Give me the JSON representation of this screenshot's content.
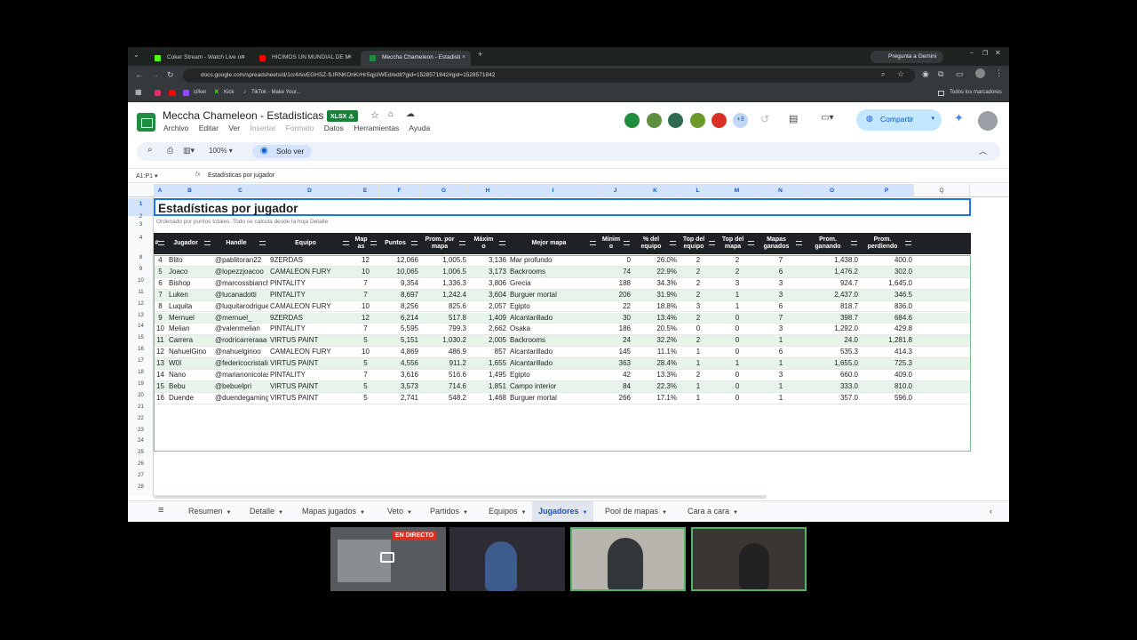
{
  "browser": {
    "tabs": [
      {
        "label": "Coker Stream - Watch Live on"
      },
      {
        "label": "HICIMOS UN MUNDIAL DE M"
      },
      {
        "label": "Meccha Chameleon - Estadisti"
      }
    ],
    "new_tab": "+",
    "gemini": "Pregunta a Gemini",
    "url": "docs.google.com/spreadsheets/d/1cr4AivEGHSZ-fLIRNKOnKrHrSqjclWEd/edit?gid=1528571842#gid=1528571842",
    "bookmarks": [
      "cl/ker",
      "Kick",
      "TikTok - Make Your..."
    ],
    "all_bookmarks": "Todos los marcadores"
  },
  "sheet": {
    "title": "Meccha Chameleon - Estadisticas",
    "badge": "XLSX",
    "menus": [
      "Archivo",
      "Editar",
      "Ver",
      "Insertar",
      "Formato",
      "Datos",
      "Herramientas",
      "Ayuda"
    ],
    "collaborators_more": "+3",
    "share": "Compartir",
    "zoom": "100%",
    "view_mode": "Solo ver",
    "name_box": "A1:P1",
    "fx": "fx",
    "formula": "Estadísticas por jugador"
  },
  "columns": [
    "A",
    "B",
    "C",
    "D",
    "E",
    "F",
    "G",
    "H",
    "I",
    "J",
    "K",
    "L",
    "M",
    "N",
    "O",
    "P",
    "Q"
  ],
  "row_numbers": [
    "1",
    "2",
    "3",
    "4",
    "8",
    "9",
    "10",
    "11",
    "12",
    "13",
    "14",
    "15",
    "16",
    "17",
    "18",
    "19",
    "20",
    "21",
    "22",
    "23",
    "24",
    "25",
    "26",
    "27",
    "28"
  ],
  "content": {
    "heading": "Estadísticas por jugador",
    "subheading": "Ordenado por puntos totales. Todo se calcula desde la hoja Detalle",
    "headers": [
      "#",
      "Jugador",
      "Handle",
      "Equipo",
      "Map\nas",
      "Puntos",
      "Prom. por\nmapa",
      "Máxim\no",
      "Mejor mapa",
      "Mínim\no",
      "% del\nequipo",
      "Top del\nequipo",
      "Top del\nmapa",
      "Mapas\nganados",
      "Prom.\nganando",
      "Prom.\nperdiendo"
    ],
    "rows": [
      [
        "4",
        "Blito",
        "@pablitoran22",
        "9ZERDAS",
        "12",
        "12,066",
        "1,005.5",
        "3,136",
        "Mar profundo",
        "0",
        "26.0%",
        "2",
        "2",
        "7",
        "1,438.0",
        "400.0"
      ],
      [
        "5",
        "Joaco",
        "@lopezzjoacoo",
        "CAMALEON FURY",
        "10",
        "10,065",
        "1,006.5",
        "3,173",
        "Backrooms",
        "74",
        "22.9%",
        "2",
        "2",
        "6",
        "1,476.2",
        "302.0"
      ],
      [
        "6",
        "Bishop",
        "@marcossbianchi",
        "PINTALITY",
        "7",
        "9,354",
        "1,336.3",
        "3,806",
        "Grecia",
        "188",
        "34.3%",
        "2",
        "3",
        "3",
        "924.7",
        "1,645.0"
      ],
      [
        "7",
        "Luken",
        "@lucanadotti",
        "PINTALITY",
        "7",
        "8,697",
        "1,242.4",
        "3,604",
        "Burguer mortal",
        "206",
        "31.9%",
        "2",
        "1",
        "3",
        "2,437.0",
        "346.5"
      ],
      [
        "8",
        "Luquita",
        "@luquitarodrigue",
        "CAMALEON FURY",
        "10",
        "8,256",
        "825.6",
        "2,057",
        "Egipto",
        "22",
        "18.8%",
        "3",
        "1",
        "6",
        "818.7",
        "836.0"
      ],
      [
        "9",
        "Mernuel",
        "@mernuel_",
        "9ZERDAS",
        "12",
        "6,214",
        "517.8",
        "1,409",
        "Alcantarillado",
        "30",
        "13.4%",
        "2",
        "0",
        "7",
        "398.7",
        "684.6"
      ],
      [
        "10",
        "Melian",
        "@valenmelian",
        "PINTALITY",
        "7",
        "5,595",
        "799.3",
        "2,662",
        "Osaka",
        "186",
        "20.5%",
        "0",
        "0",
        "3",
        "1,292.0",
        "429.8"
      ],
      [
        "11",
        "Carrera",
        "@rodricarreraaa",
        "VIRTUS PAINT",
        "5",
        "5,151",
        "1,030.2",
        "2,005",
        "Backrooms",
        "24",
        "32.2%",
        "2",
        "0",
        "1",
        "24.0",
        "1,281.8"
      ],
      [
        "12",
        "NahuelGino",
        "@nahuelginoo",
        "CAMALEON FURY",
        "10",
        "4,869",
        "486.9",
        "857",
        "Alcantarillado",
        "145",
        "11.1%",
        "1",
        "0",
        "6",
        "535.3",
        "414.3"
      ],
      [
        "13",
        "W0I",
        "@federicocristalino",
        "VIRTUS PAINT",
        "5",
        "4,556",
        "911.2",
        "1,655",
        "Alcantarillado",
        "363",
        "28.4%",
        "1",
        "1",
        "1",
        "1,655.0",
        "725.3"
      ],
      [
        "14",
        "Nano",
        "@marianonicolas",
        "PINTALITY",
        "7",
        "3,616",
        "516.6",
        "1,495",
        "Egipto",
        "42",
        "13.3%",
        "2",
        "0",
        "3",
        "660.0",
        "409.0"
      ],
      [
        "15",
        "Bebu",
        "@bebuelpri",
        "VIRTUS PAINT",
        "5",
        "3,573",
        "714.6",
        "1,851",
        "Campo interior",
        "84",
        "22.3%",
        "1",
        "0",
        "1",
        "333.0",
        "810.0"
      ],
      [
        "16",
        "Duende",
        "@duendegaming",
        "VIRTUS PAINT",
        "5",
        "2,741",
        "548.2",
        "1,468",
        "Burguer mortal",
        "266",
        "17.1%",
        "1",
        "0",
        "1",
        "357.0",
        "596.0"
      ]
    ]
  },
  "sheet_tabs": [
    "Resumen",
    "Detalle",
    "Mapas jugados",
    "Veto",
    "Partidos",
    "Equipos",
    "Jugadores",
    "Pool de mapas",
    "Cara a cara"
  ],
  "active_sheet_tab": "Jugadores",
  "stream": {
    "live_badge": "EN DIRECTO"
  },
  "colors": {
    "accent": "#1a73e8",
    "alt_row": "#e6f4ea",
    "header_bg": "#202124",
    "live": "#d93025"
  }
}
